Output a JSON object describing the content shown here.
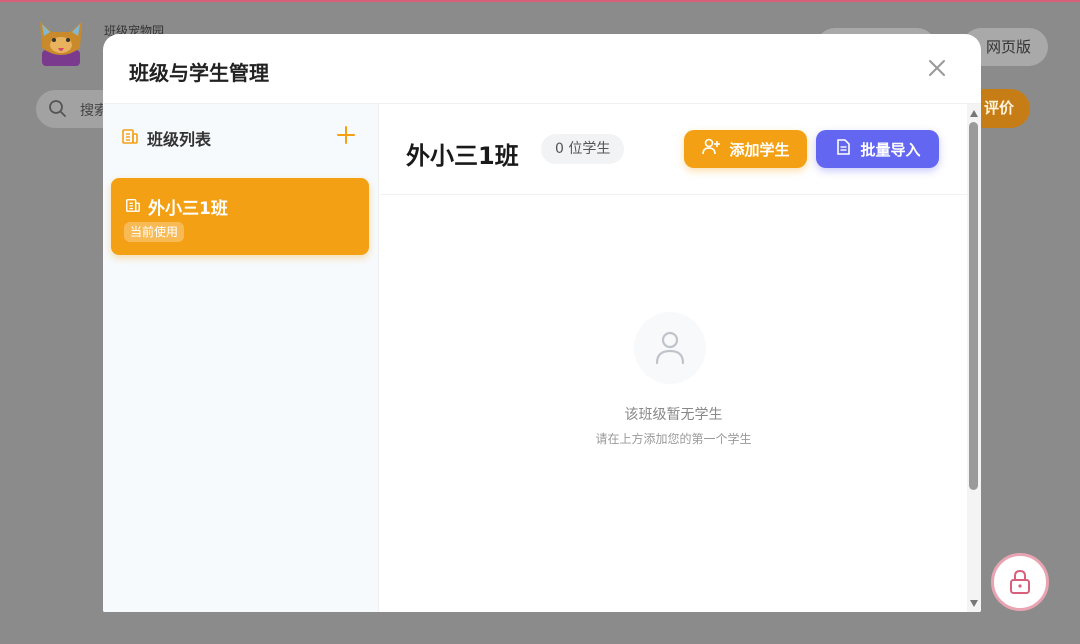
{
  "background": {
    "app_name": "班级宠物园",
    "web_label": "网页版",
    "search_placeholder": "搜索",
    "eval_label": "评价"
  },
  "modal": {
    "title": "班级与学生管理",
    "close_icon": "close-icon"
  },
  "class_list": {
    "title": "班级列表",
    "icon": "building-icon",
    "add_icon": "plus-icon",
    "items": [
      {
        "name": "外小三1班",
        "badge": "当前使用",
        "selected": true
      }
    ]
  },
  "detail": {
    "class_name": "外小三1班",
    "student_count": "0 位学生",
    "add_button": "添加学生",
    "import_button": "批量导入",
    "empty_title": "该班级暂无学生",
    "empty_subtitle": "请在上方添加您的第一个学生"
  },
  "colors": {
    "accent": "#f4a014",
    "import": "#6366f1",
    "lock_border": "#e8a4b3"
  }
}
